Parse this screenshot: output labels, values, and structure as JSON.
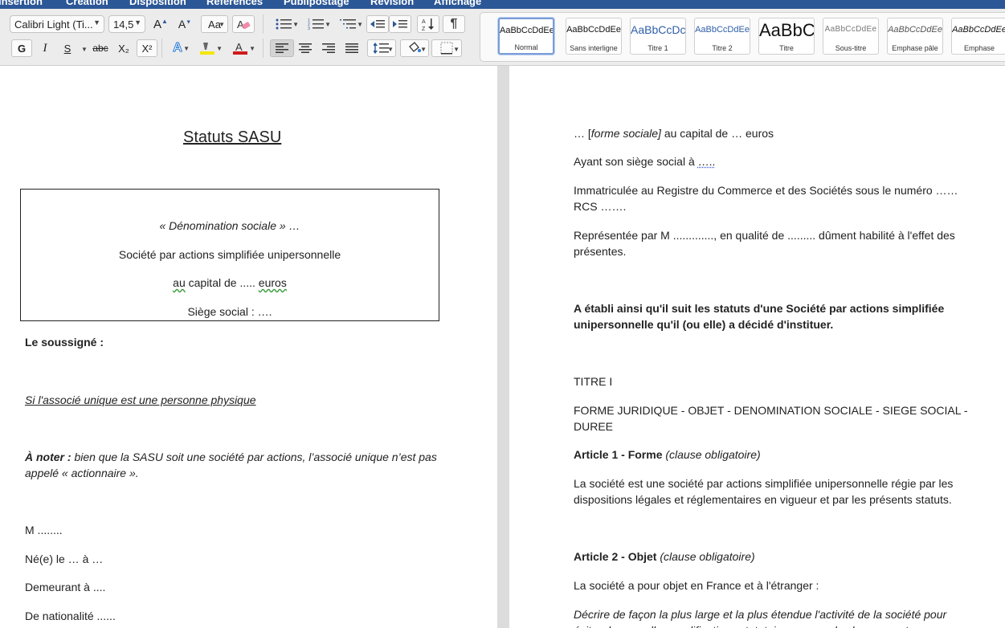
{
  "menu": {
    "items": [
      "Insertion",
      "Création",
      "Disposition",
      "Références",
      "Publipostage",
      "Révision",
      "Affichage"
    ]
  },
  "ribbon": {
    "font_name": "Calibri Light (Ti...",
    "font_size": "14,5",
    "bold": "G",
    "italic": "I",
    "underline": "S",
    "strikethrough": "abc",
    "subscript": "X₂",
    "superscript": "X²",
    "styles": [
      {
        "preview": "AaBbCcDdEe",
        "name": "Normal"
      },
      {
        "preview": "AaBbCcDdEe",
        "name": "Sans interligne"
      },
      {
        "preview": "AaBbCcDc",
        "name": "Titre 1"
      },
      {
        "preview": "AaBbCcDdEe",
        "name": "Titre 2"
      },
      {
        "preview": "AaBbC",
        "name": "Titre"
      },
      {
        "preview": "AaBbCcDdEe",
        "name": "Sous-titre"
      },
      {
        "preview": "AaBbCcDdEe",
        "name": "Emphase pâle"
      },
      {
        "preview": "AaBbCcDdEe",
        "name": "Emphase"
      }
    ],
    "colors": {
      "highlight": "#f5e600",
      "font_color": "#d11a1a",
      "menubar": "#2b5797"
    }
  },
  "left_page": {
    "title": "Statuts SASU",
    "box": {
      "denomination_prefix": "« ",
      "denomination": "Dénomination sociale",
      "denomination_suffix": " » …",
      "line2": "Société par actions simplifiée unipersonnelle",
      "line3_a": "au",
      "line3_b": " capital de ..... ",
      "line3_c": "euros",
      "line4": "Siège social : …."
    },
    "soussigne": "Le soussigné :",
    "personne_physique": "Si l'associé unique est une personne physique",
    "a_noter_label": "À noter :",
    "a_noter_text": " bien que la SASU soit une société par actions, l’associé unique n’est pas appelé « actionnaire ».",
    "m": "M ........",
    "ne_le": "Né(e) le … à …",
    "demeurant": "Demeurant à ....",
    "nationalite": "De nationalité ......"
  },
  "right_page": {
    "forme_a": "… [",
    "forme_b": "forme sociale]",
    "forme_c": " au capital de … euros",
    "siege_a": "Ayant son siège social à ",
    "siege_b": "…..",
    "immatriculee": "Immatriculée au Registre du Commerce et des Sociétés sous le numéro …… RCS …….",
    "representee": "Représentée par M ............., en qualité de ......... dûment habilité à l'effet des présentes.",
    "etabli": "A établi ainsi qu'il suit les statuts d'une Société par actions simplifiée unipersonnelle qu'il (ou elle) a décidé d'instituer.",
    "titre": "TITRE I",
    "forme_juridique": "FORME JURIDIQUE - OBJET - DENOMINATION SOCIALE - SIEGE SOCIAL - DUREE",
    "art1_label": "Article 1 - Forme ",
    "art1_clause": "(clause obligatoire)",
    "art1_text": "La société est une société par actions simplifiée unipersonnelle régie par les dispositions légales et réglementaires en vigueur et par les présents statuts.",
    "art2_label": "Article 2 - Objet ",
    "art2_clause": "(clause obligatoire)",
    "art2_text": "La société a pour objet en France et à l'étranger :",
    "art2_decrire": "Décrire de façon la plus large et la plus étendue l'activité de la société pour éviter de nouvelles modifications statutaires en cas de changement"
  }
}
